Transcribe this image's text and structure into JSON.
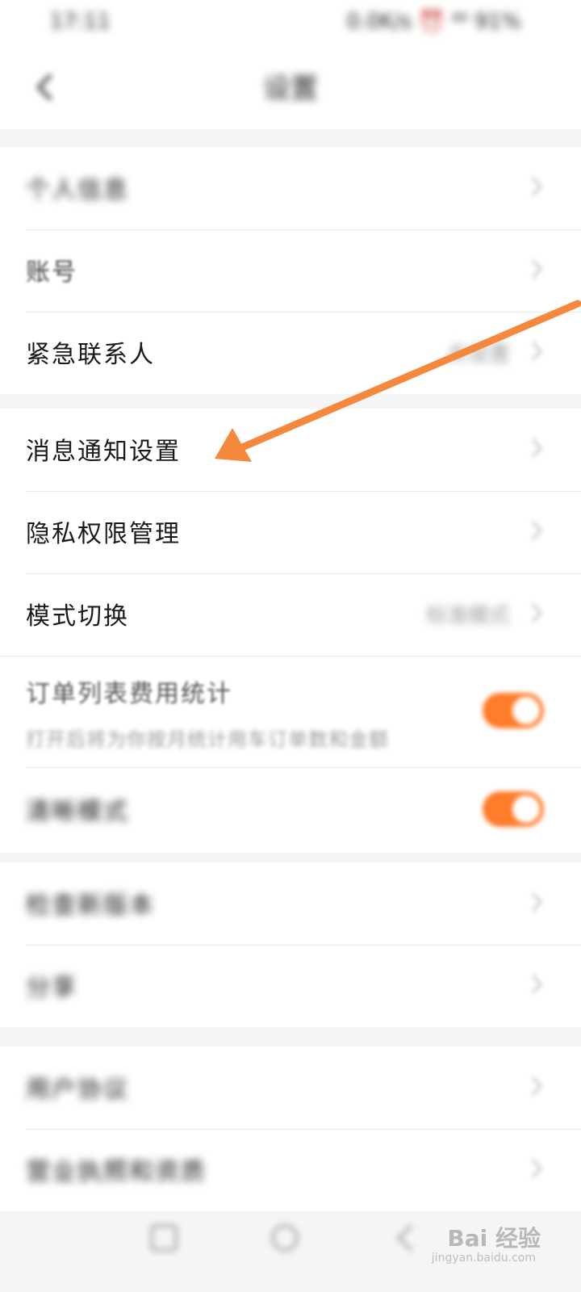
{
  "status_bar": {
    "time": "17:11",
    "right": "0.0K/s ⏰ ⁴⁶ 91%"
  },
  "header": {
    "title": "设置"
  },
  "groups": [
    {
      "items": [
        {
          "label": "个人信息"
        },
        {
          "label": "账号"
        },
        {
          "label": "紧急联系人",
          "value": "未设置"
        }
      ]
    },
    {
      "items": [
        {
          "label": "消息通知设置"
        },
        {
          "label": "隐私权限管理"
        },
        {
          "label": "模式切换",
          "value": "标准模式"
        },
        {
          "label": "订单列表费用统计",
          "subtitle": "打开后将为你按月统计用车订单数和金额",
          "toggle": true
        },
        {
          "label": "清晰模式",
          "toggle": true
        }
      ]
    },
    {
      "items": [
        {
          "label": "检查新版本"
        },
        {
          "label": "分享"
        }
      ]
    },
    {
      "items": [
        {
          "label": "用户协议"
        },
        {
          "label": "营业执照和资质"
        }
      ]
    }
  ],
  "watermark": {
    "text": "Bai 经验",
    "sub": "jingyan.baidu.com"
  },
  "colors": {
    "accent": "#ff7c2b",
    "arrow": "#f4883c"
  }
}
